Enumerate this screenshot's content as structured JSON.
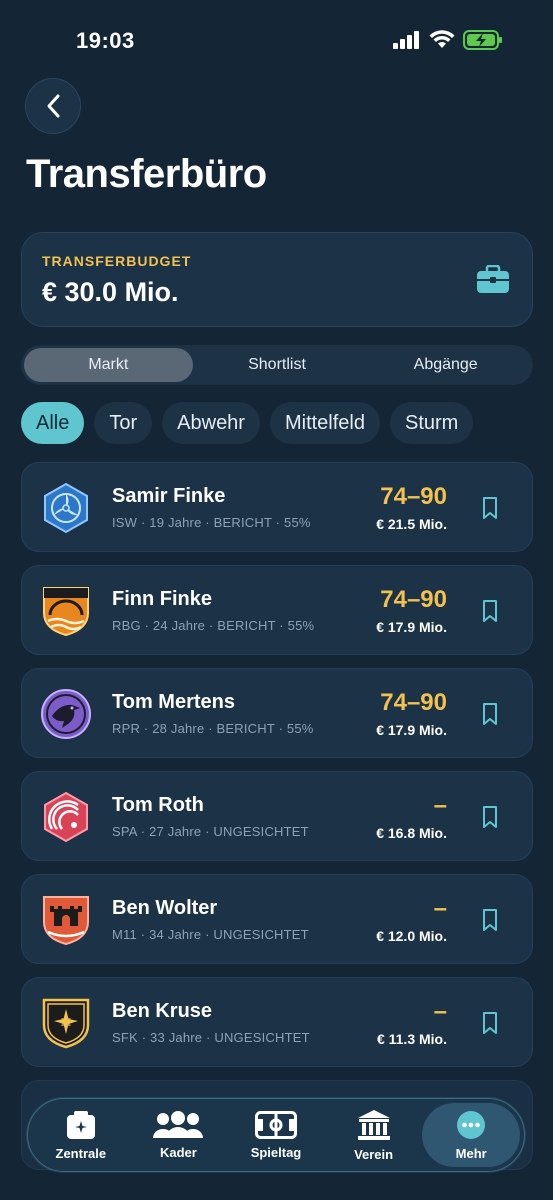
{
  "status": {
    "time": "19:03"
  },
  "page": {
    "title": "Transferbüro"
  },
  "budget": {
    "label": "TRANSFERBUDGET",
    "value": "€ 30.0 Mio."
  },
  "segments": [
    {
      "label": "Markt",
      "active": true
    },
    {
      "label": "Shortlist",
      "active": false
    },
    {
      "label": "Abgänge",
      "active": false
    }
  ],
  "filters": [
    {
      "label": "Alle",
      "active": true
    },
    {
      "label": "Tor",
      "active": false
    },
    {
      "label": "Abwehr",
      "active": false
    },
    {
      "label": "Mittelfeld",
      "active": false
    },
    {
      "label": "Sturm",
      "active": false
    }
  ],
  "players": [
    {
      "name": "Samir Finke",
      "meta": "ISW · 19 Jahre · BERICHT · 55%",
      "range": "74–90",
      "price": "€ 21.5 Mio.",
      "crest": "propeller-crest-icon"
    },
    {
      "name": "Finn Finke",
      "meta": "RBG · 24 Jahre · BERICHT · 55%",
      "range": "74–90",
      "price": "€ 17.9 Mio.",
      "crest": "bridge-crest-icon"
    },
    {
      "name": "Tom Mertens",
      "meta": "RPR · 28 Jahre · BERICHT · 55%",
      "range": "74–90",
      "price": "€ 17.9 Mio.",
      "crest": "raven-crest-icon"
    },
    {
      "name": "Tom Roth",
      "meta": "SPA · 27 Jahre · UNGESICHTET",
      "range": "–",
      "price": "€ 16.8 Mio.",
      "crest": "wave-crest-icon"
    },
    {
      "name": "Ben Wolter",
      "meta": "M11 · 34 Jahre · UNGESICHTET",
      "range": "–",
      "price": "€ 12.0 Mio.",
      "crest": "castle-crest-icon"
    },
    {
      "name": "Ben Kruse",
      "meta": "SFK · 33 Jahre · UNGESICHTET",
      "range": "–",
      "price": "€ 11.3 Mio.",
      "crest": "star-crest-icon"
    }
  ],
  "tabs": [
    {
      "label": "Zentrale",
      "icon": "board-icon"
    },
    {
      "label": "Kader",
      "icon": "team-icon"
    },
    {
      "label": "Spieltag",
      "icon": "pitch-icon"
    },
    {
      "label": "Verein",
      "icon": "building-icon"
    },
    {
      "label": "Mehr",
      "icon": "more-icon"
    }
  ],
  "colors": {
    "accent": "#5fc6d0",
    "gold": "#f2c14e",
    "background": "#142536",
    "card": "#1c3247"
  }
}
